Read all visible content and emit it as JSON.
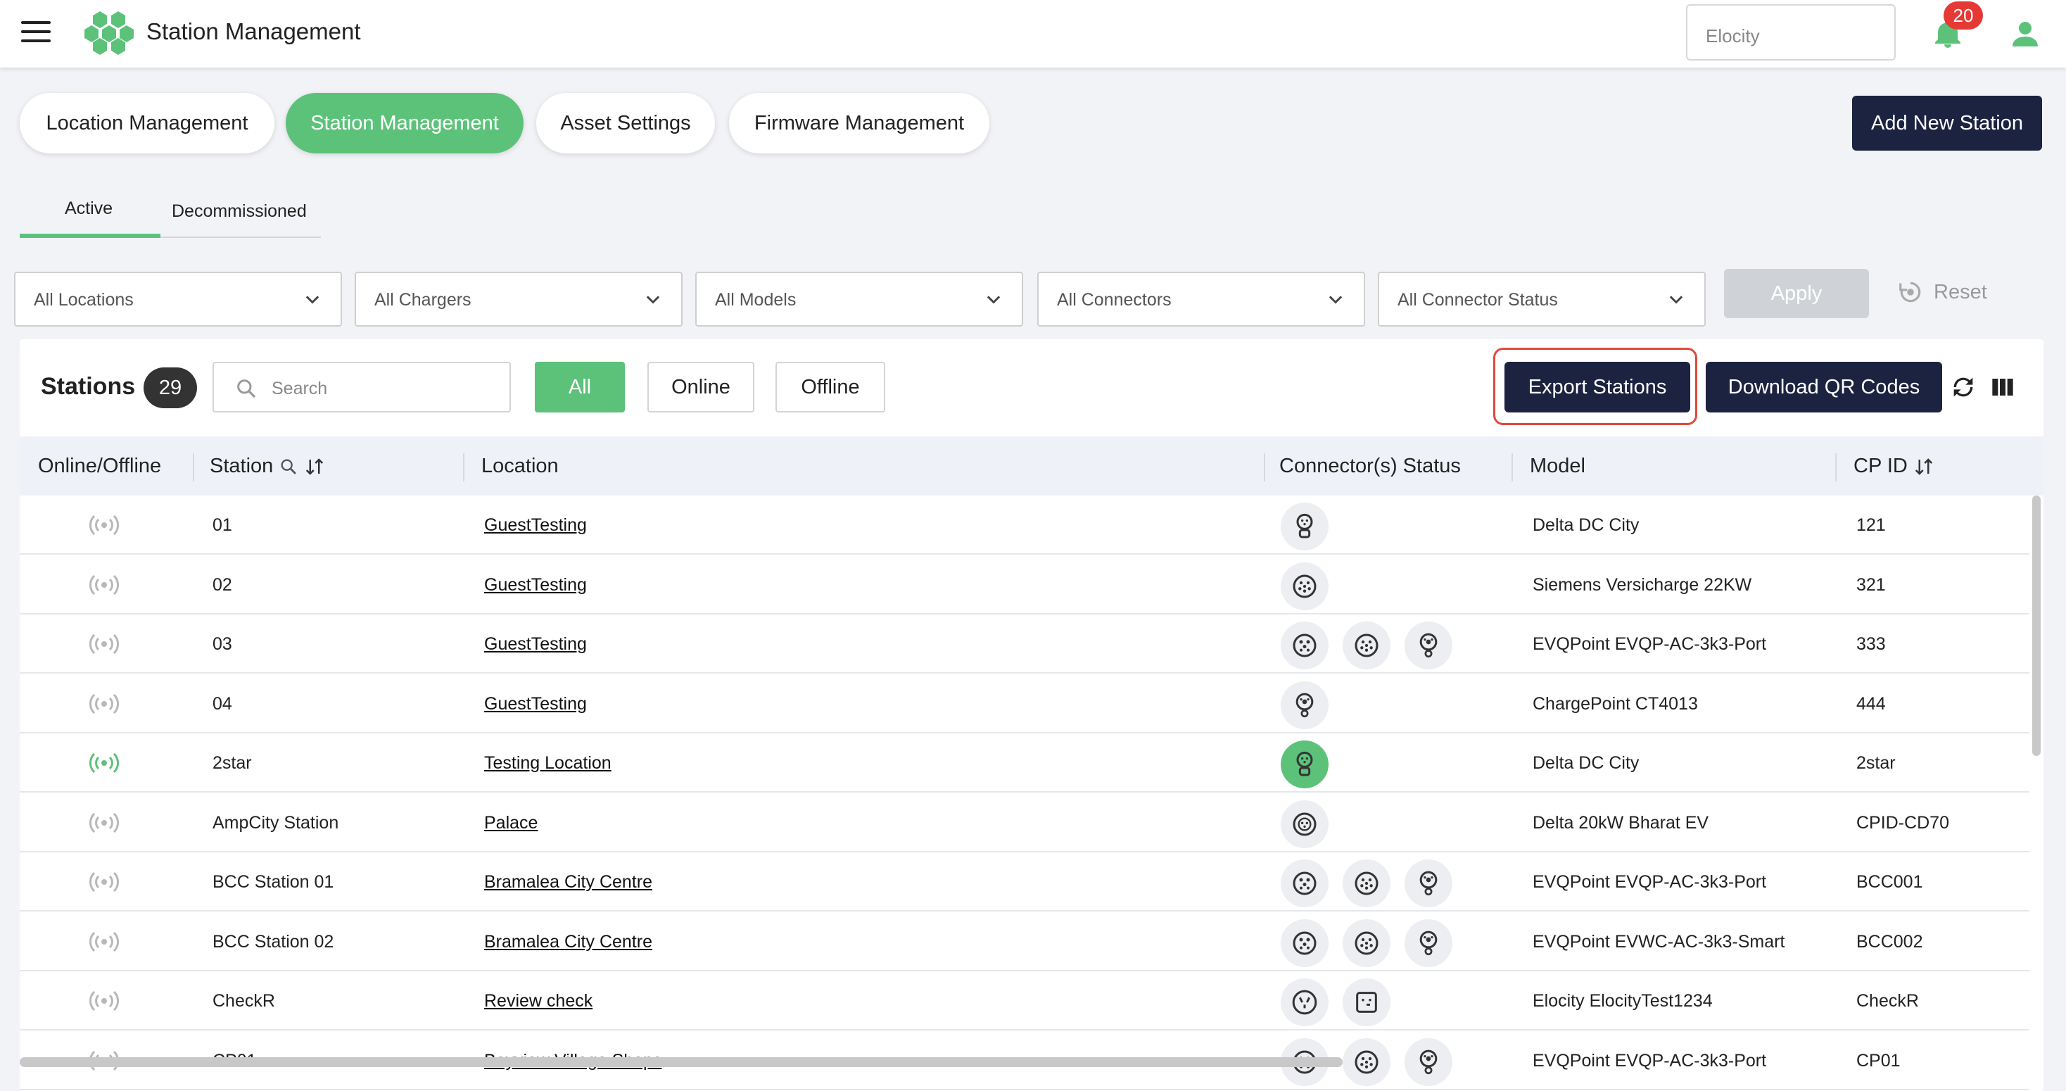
{
  "header": {
    "app_title": "Station Management",
    "org_placeholder": "Elocity",
    "notification_count": "20"
  },
  "nav": {
    "pills": [
      "Location Management",
      "Station Management",
      "Asset Settings",
      "Firmware Management"
    ],
    "active_index": 1,
    "add_button": "Add New Station"
  },
  "subtabs": {
    "active": "Active",
    "decommissioned": "Decommissioned"
  },
  "filters": {
    "locations": "All Locations",
    "chargers": "All Chargers",
    "models": "All Models",
    "connectors": "All Connectors",
    "connector_status": "All Connector Status",
    "apply": "Apply",
    "reset": "Reset"
  },
  "stations": {
    "title": "Stations",
    "count": "29",
    "search_placeholder": "Search",
    "seg_all": "All",
    "seg_online": "Online",
    "seg_offline": "Offline",
    "export_button": "Export Stations",
    "qr_button": "Download QR Codes"
  },
  "table": {
    "headers": {
      "online": "Online/Offline",
      "station": "Station",
      "location": "Location",
      "connectors": "Connector(s) Status",
      "model": "Model",
      "cpid": "CP ID"
    },
    "rows": [
      {
        "station": "01",
        "location": "GuestTesting",
        "model": "Delta DC City",
        "cpid": "121"
      },
      {
        "station": "02",
        "location": "GuestTesting",
        "model": "Siemens Versicharge 22KW",
        "cpid": "321"
      },
      {
        "station": "03",
        "location": "GuestTesting",
        "model": "EVQPoint EVQP-AC-3k3-Port",
        "cpid": "333"
      },
      {
        "station": "04",
        "location": "GuestTesting",
        "model": "ChargePoint CT4013",
        "cpid": "444"
      },
      {
        "station": "2star",
        "location": "Testing Location",
        "model": "Delta DC City",
        "cpid": "2star"
      },
      {
        "station": "AmpCity Station",
        "location": "Palace",
        "model": "Delta 20kW Bharat EV",
        "cpid": "CPID-CD70"
      },
      {
        "station": "BCC Station 01",
        "location": "Bramalea City Centre",
        "model": "EVQPoint EVQP-AC-3k3-Port",
        "cpid": "BCC001"
      },
      {
        "station": "BCC Station 02",
        "location": "Bramalea City Centre",
        "model": "EVQPoint EVWC-AC-3k3-Smart",
        "cpid": "BCC002"
      },
      {
        "station": "CheckR",
        "location": "Review check",
        "model": "Elocity ElocityTest1234",
        "cpid": "CheckR"
      },
      {
        "station": "CP01",
        "location": "Bayview Village Shops",
        "model": "EVQPoint EVQP-AC-3k3-Port",
        "cpid": "CP01"
      }
    ]
  },
  "colors": {
    "accent_green": "#5cc27a",
    "navy": "#1c2340",
    "badge_red": "#e53935",
    "highlight_red": "#e04a3a"
  }
}
